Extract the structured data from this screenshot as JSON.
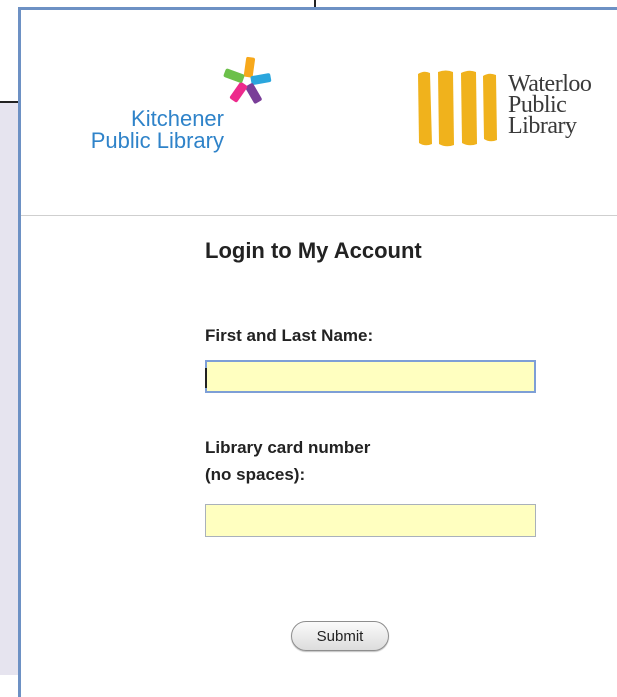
{
  "logos": {
    "kitchener": {
      "line1": "Kitchener",
      "line2": "Public Library",
      "text_color": "#2f83c9",
      "mark_colors": [
        "#6cc04a",
        "#2aa6dd",
        "#ed2a8c",
        "#f7a81b",
        "#7a3e98"
      ]
    },
    "waterloo": {
      "line1": "Waterloo",
      "line2": "Public",
      "line3": "Library",
      "bar_color": "#f0b21c"
    }
  },
  "login": {
    "title": "Login to My Account",
    "name_label": "First and Last Name:",
    "name_value": "",
    "card_label_line1": "Library card number",
    "card_label_line2": "(no spaces):",
    "card_value": "",
    "submit_label": "Submit"
  },
  "colors": {
    "field_background": "#ffffc0",
    "window_border": "#6d91c4",
    "background_panel": "#e6e4ef"
  }
}
